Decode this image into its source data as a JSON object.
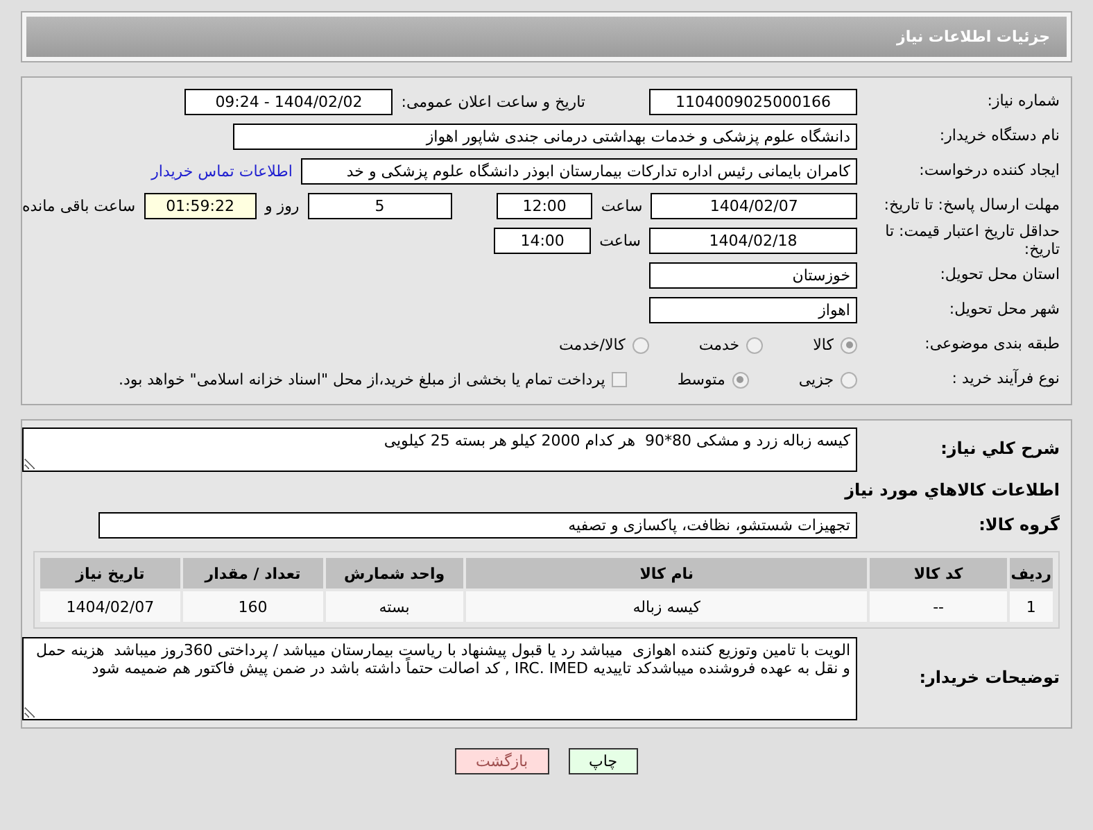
{
  "header": {
    "title": "جزئیات اطلاعات نیاز"
  },
  "details": {
    "need_number": {
      "label": "شماره نیاز:",
      "value": "1104009025000166"
    },
    "announce": {
      "label": "تاریخ و ساعت اعلان عمومی:",
      "value": "1404/02/02 - 09:24"
    },
    "buyer_org": {
      "label": "نام دستگاه خریدار:",
      "value": "دانشگاه علوم پزشکی و خدمات بهداشتی درمانی جندی شاپور اهواز"
    },
    "requester": {
      "label": "ایجاد کننده درخواست:",
      "value": "کامران بایمانی رئیس اداره تدارکات بیمارستان ابوذر  دانشگاه علوم پزشکی و خد",
      "link": "اطلاعات تماس خریدار"
    },
    "deadline": {
      "label": "مهلت ارسال پاسخ: تا تاریخ:",
      "date": "1404/02/07",
      "time_label": "ساعت",
      "time": "12:00",
      "days": "5",
      "days_label": "روز و",
      "remaining": "01:59:22",
      "remaining_label": "ساعت باقی مانده"
    },
    "validity": {
      "label": "حداقل تاریخ اعتبار قیمت: تا تاریخ:",
      "date": "1404/02/18",
      "time_label": "ساعت",
      "time": "14:00"
    },
    "province": {
      "label": "استان محل تحویل:",
      "value": "خوزستان"
    },
    "city": {
      "label": "شهر محل تحویل:",
      "value": "اهواز"
    },
    "category": {
      "label": "طبقه بندی موضوعی:",
      "options": [
        {
          "label": "کالا",
          "selected": true
        },
        {
          "label": "خدمت",
          "selected": false
        },
        {
          "label": "کالا/خدمت",
          "selected": false
        }
      ]
    },
    "process": {
      "label": "نوع فرآیند خرید :",
      "options": [
        {
          "label": "جزیی",
          "selected": false
        },
        {
          "label": "متوسط",
          "selected": true
        }
      ],
      "payment": {
        "checked": false,
        "text": "پرداخت تمام یا بخشی از مبلغ خرید،از محل \"اسناد خزانه اسلامی\" خواهد بود."
      }
    }
  },
  "need": {
    "description": {
      "label": "شرح كلي نياز:",
      "value": "کیسه زباله زرد و مشکی 80*90  هر کدام 2000 کیلو هر بسته 25 کیلویی"
    },
    "goods_heading": "اطلاعات كالاهاي مورد نياز",
    "group": {
      "label": "گروه کالا:",
      "value": "تجهیزات شستشو، نظافت، پاکسازی و تصفیه"
    },
    "table": {
      "columns": [
        "ردیف",
        "کد کالا",
        "نام کالا",
        "واحد شمارش",
        "تعداد / مقدار",
        "تاریخ نیاز"
      ],
      "rows": [
        [
          "1",
          "--",
          "کیسه زباله",
          "بسته",
          "160",
          "1404/02/07"
        ]
      ]
    },
    "buyer_notes": {
      "label": "توضیحات خریدار:",
      "value": "الویت با تامین وتوزیع کننده اهوازی  میباشد رد یا قبول پیشنهاد با ریاست بیمارستان میباشد / پرداختی 360روز میباشد  هزینه حمل و نقل به عهده فروشنده میباشدکد تاییدیه IRC. IMED , کد اصالت حتماً داشته باشد در ضمن پیش فاکتور هم ضمیمه شود"
    }
  },
  "buttons": [
    {
      "label": "چاپ",
      "kind": "print"
    },
    {
      "label": "بازگشت",
      "kind": "back"
    }
  ]
}
